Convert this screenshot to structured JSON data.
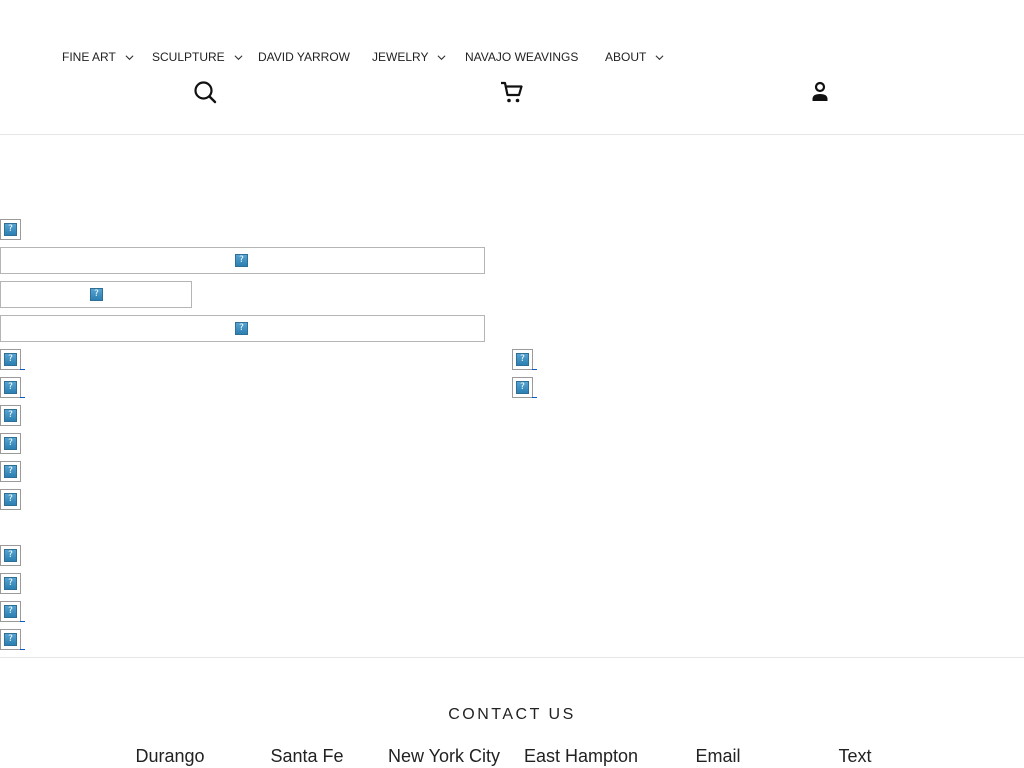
{
  "nav": {
    "items": [
      {
        "label": "FINE ART",
        "dropdown": true
      },
      {
        "label": "SCULPTURE",
        "dropdown": true
      },
      {
        "label": "DAVID YARROW",
        "dropdown": false
      },
      {
        "label": "JEWELRY",
        "dropdown": true
      },
      {
        "label": "NAVAJO WEAVINGS",
        "dropdown": false
      },
      {
        "label": "ABOUT",
        "dropdown": true
      }
    ]
  },
  "icons": {
    "search": "search-icon",
    "cart": "cart-icon",
    "account": "account-icon",
    "broken_image": "broken-image-icon",
    "broken_glyph": "?"
  },
  "contact": {
    "title": "CONTACT US",
    "links": [
      "Durango",
      "Santa Fe",
      "New York City",
      "East Hampton",
      "Email",
      "Text"
    ]
  },
  "colors": {
    "text": "#222222",
    "divider": "#e6e6e6",
    "broken_icon": "#2c7fb2"
  }
}
